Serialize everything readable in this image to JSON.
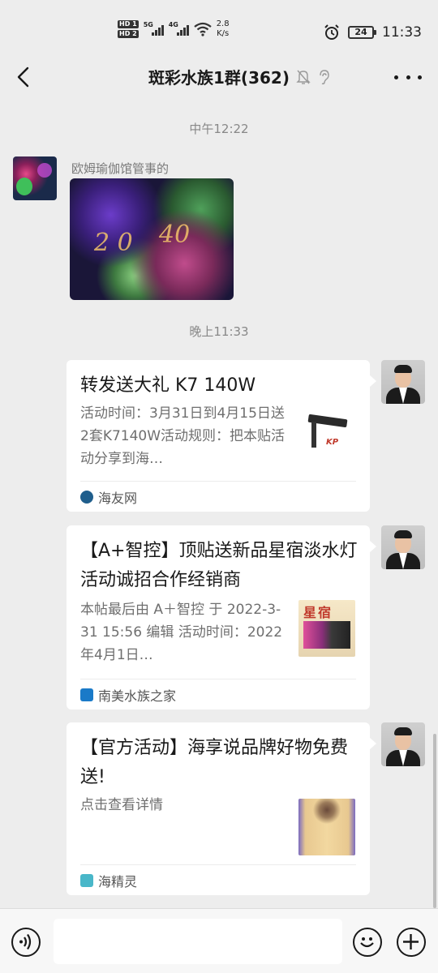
{
  "status_bar": {
    "hd1": "HD 1",
    "hd2": "HD 2",
    "net1": "5G",
    "net2": "4G",
    "speed_value": "2.8",
    "speed_unit": "K/s",
    "battery": "24",
    "time": "11:33"
  },
  "nav": {
    "title": "斑彩水族1群(362)"
  },
  "messages": {
    "time1": "中午12:22",
    "sender1": "欧姆瑜伽馆管事的",
    "time2": "晚上11:33",
    "cards": [
      {
        "title": "转发送大礼 K7 140W",
        "desc": "活动时间：3月31日到4月15日送2套K7140W活动规则：把本贴活动分享到海…",
        "source": "海友网",
        "thumb_logo": "KP"
      },
      {
        "title": "【A+智控】顶贴送新品星宿淡水灯活动诚招合作经销商",
        "desc": " 本帖最后由 A＋智控 于 2022-3-31 15:56 编辑 活动时间：2022年4月1日…",
        "source": "南美水族之家",
        "thumb_text": "星宿"
      },
      {
        "title": "【官方活动】海享说品牌好物免费送!",
        "desc": "点击查看详情",
        "source": "海精灵"
      }
    ]
  },
  "colors": {
    "background": "#ededed",
    "card": "#ffffff",
    "muted_text": "#888888",
    "source_icon_1": "#1f5e8c",
    "source_icon_2": "#1a7ac8",
    "source_icon_3": "#49b7c9"
  },
  "icons": [
    "back-arrow-icon",
    "mute-bell-icon",
    "ear-icon",
    "more-icon",
    "voice-icon",
    "emoji-icon",
    "plus-icon"
  ]
}
